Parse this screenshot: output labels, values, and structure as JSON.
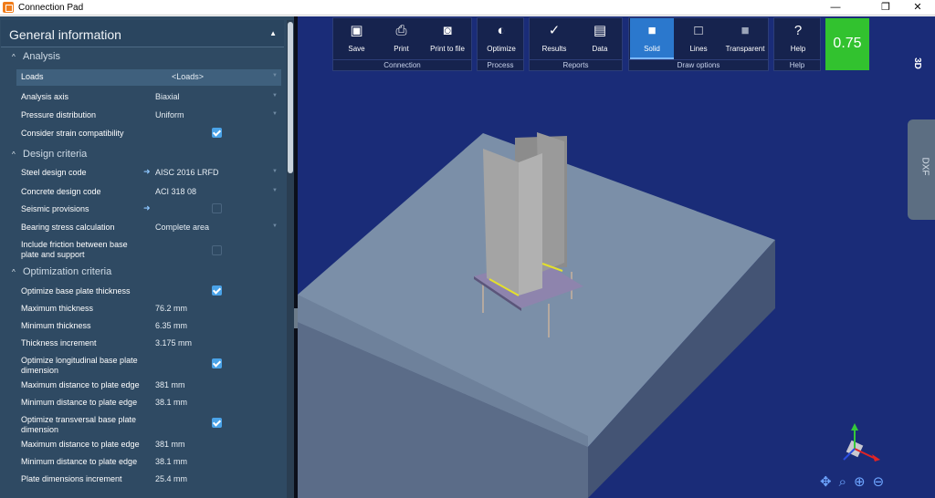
{
  "window": {
    "title": "Connection Pad",
    "controls": [
      "—",
      "❐",
      "✕"
    ]
  },
  "panel": {
    "header": "General information",
    "sections": {
      "analysis": "Analysis",
      "design": "Design criteria",
      "optimization": "Optimization criteria"
    },
    "rows": {
      "loads": {
        "label": "Loads",
        "value": "<Loads>"
      },
      "axis": {
        "label": "Analysis axis",
        "value": "Biaxial"
      },
      "pressure": {
        "label": "Pressure distribution",
        "value": "Uniform"
      },
      "strain": {
        "label": "Consider strain compatibility",
        "checked": true
      },
      "steel": {
        "label": "Steel design code",
        "value": "AISC 2016 LRFD"
      },
      "concrete": {
        "label": "Concrete design code",
        "value": "ACI 318 08"
      },
      "seismic": {
        "label": "Seismic provisions",
        "checked": false
      },
      "bearing": {
        "label": "Bearing stress calculation",
        "value": "Complete area"
      },
      "friction": {
        "label": "Include friction between base plate and support",
        "checked": false
      },
      "opt_thick": {
        "label": "Optimize base plate thickness",
        "checked": true
      },
      "max_thick": {
        "label": "Maximum thickness",
        "value": "76.2 mm"
      },
      "min_thick": {
        "label": "Minimum thickness",
        "value": "6.35 mm"
      },
      "thick_inc": {
        "label": "Thickness increment",
        "value": "3.175 mm"
      },
      "opt_long": {
        "label": "Optimize longitudinal base plate dimension",
        "checked": true
      },
      "max_edge_1": {
        "label": "Maximum distance to plate edge",
        "value": "381 mm"
      },
      "min_edge_1": {
        "label": "Minimum distance to plate edge",
        "value": "38.1 mm"
      },
      "opt_trans": {
        "label": "Optimize transversal base plate dimension",
        "checked": true
      },
      "max_edge_2": {
        "label": "Maximum distance to plate edge",
        "value": "381 mm"
      },
      "min_edge_2": {
        "label": "Minimum distance to plate edge",
        "value": "38.1 mm"
      },
      "dim_inc": {
        "label": "Plate dimensions increment",
        "value": "25.4 mm"
      }
    }
  },
  "ribbon": {
    "groups": {
      "connection": "Connection",
      "process": "Process",
      "reports": "Reports",
      "draw": "Draw options",
      "help": "Help"
    },
    "buttons": {
      "save": {
        "label": "Save",
        "icon": "save-icon"
      },
      "print": {
        "label": "Print",
        "icon": "printer-icon"
      },
      "print_file": {
        "label": "Print to file",
        "icon": "camera-icon"
      },
      "optimize": {
        "label": "Optimize",
        "icon": "optimize-icon"
      },
      "results": {
        "label": "Results",
        "icon": "results-icon"
      },
      "data": {
        "label": "Data",
        "icon": "data-icon"
      },
      "solid": {
        "label": "Solid",
        "icon": "solid-cube-icon"
      },
      "lines": {
        "label": "Lines",
        "icon": "wireframe-cube-icon"
      },
      "transparent": {
        "label": "Transparent",
        "icon": "transparent-cube-icon"
      },
      "help": {
        "label": "Help",
        "icon": "help-icon"
      }
    },
    "active_draw_option": "Solid"
  },
  "score": "0.75",
  "view_label": "3D",
  "dxf_tab": "DXF",
  "colors": {
    "panel_bg": "#2f4a63",
    "viewport_bg": "#1a2c78",
    "score_bg": "#32c22f",
    "checkbox": "#4aa3e8"
  }
}
